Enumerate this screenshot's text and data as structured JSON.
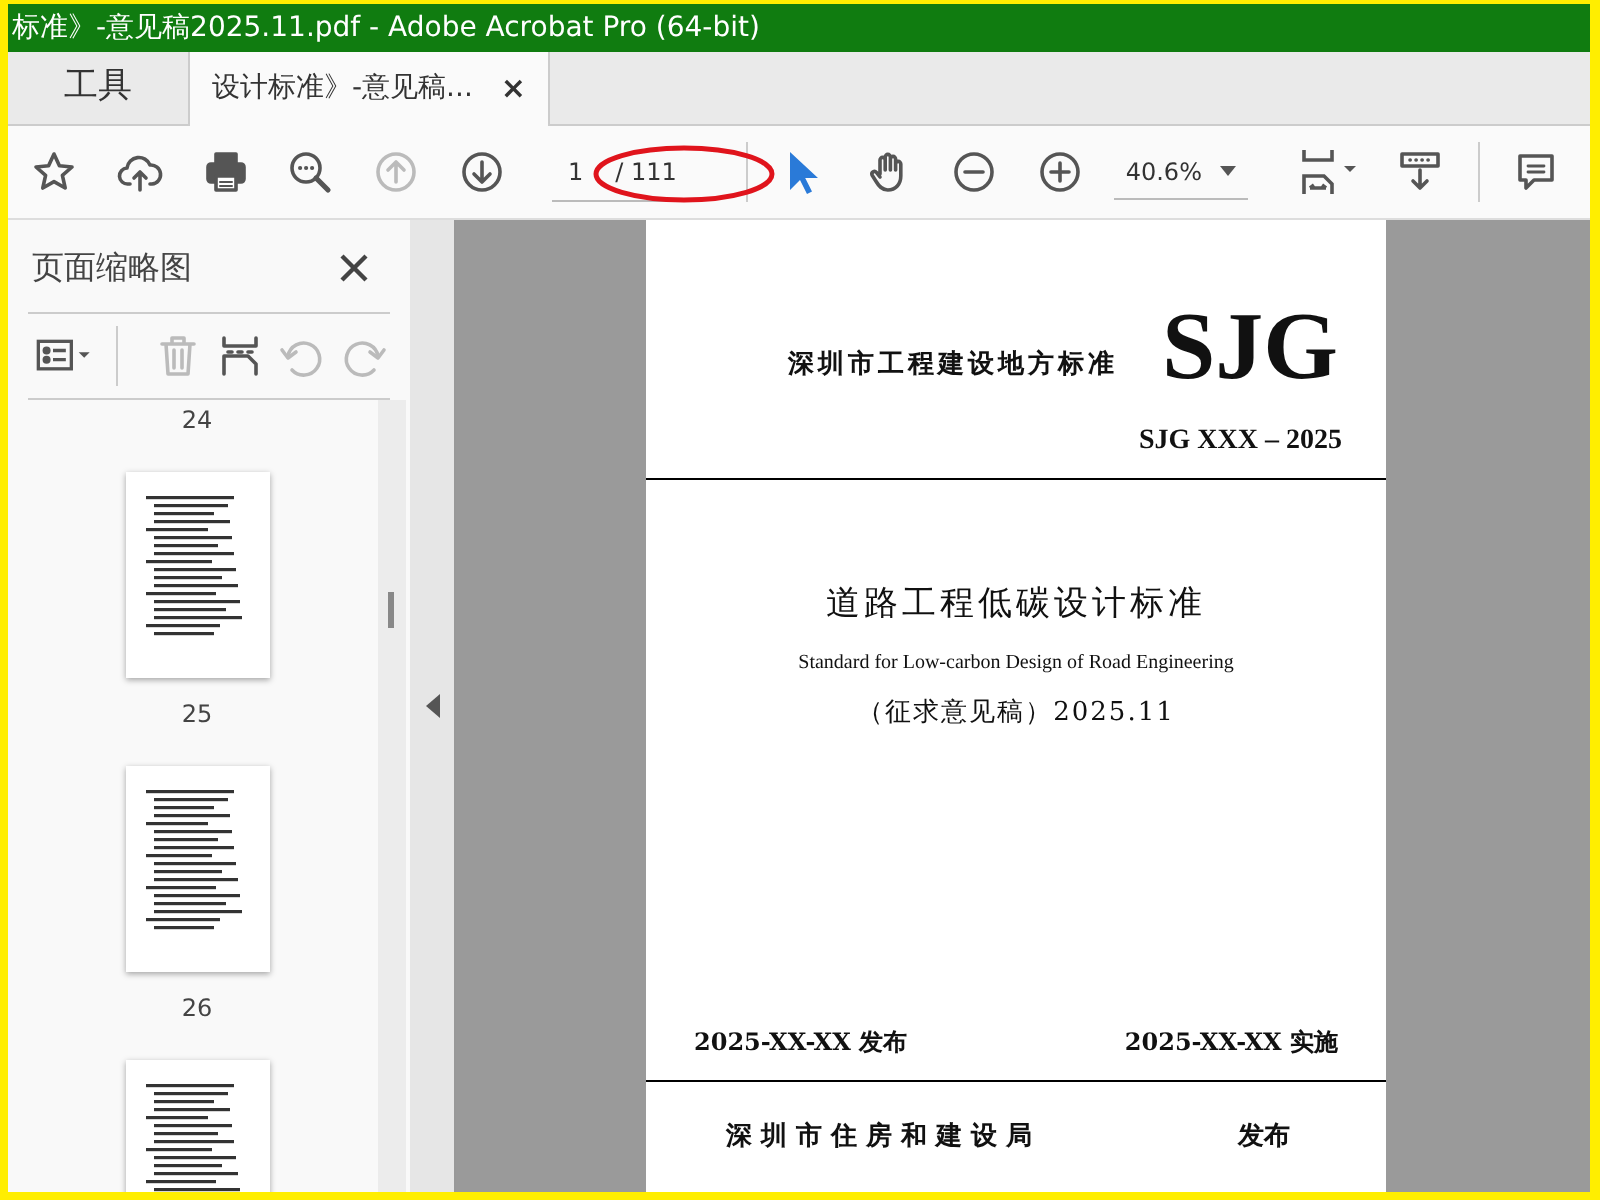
{
  "window": {
    "title": "标准》-意见稿2025.11.pdf - Adobe Acrobat Pro (64-bit)"
  },
  "tabs": [
    {
      "label": "工具",
      "selected": false
    },
    {
      "label": "设计标准》-意见稿...",
      "selected": true,
      "close": "×"
    }
  ],
  "toolbar": {
    "nav_buttons": [
      {
        "kind": "prev",
        "disabled": true
      },
      {
        "kind": "next",
        "disabled": false
      }
    ],
    "page_number": "1",
    "page_total": "/ 111",
    "zoom": "40.6%"
  },
  "sidebar": {
    "title": "页面缩略图",
    "tools": [
      {
        "kind": "delete",
        "disabled": true
      },
      {
        "kind": "insert",
        "disabled": false
      },
      {
        "kind": "rotate-left",
        "disabled": true
      },
      {
        "kind": "rotate-right",
        "disabled": true
      }
    ],
    "thumbnails": [
      {
        "kind": "label",
        "text": "24"
      },
      {
        "kind": "page"
      },
      {
        "kind": "label",
        "text": "25"
      },
      {
        "kind": "page"
      },
      {
        "kind": "label",
        "text": "26"
      },
      {
        "kind": "page"
      }
    ]
  },
  "document": {
    "org": "深圳市工程建设地方标准",
    "logo": "SJG",
    "number": "SJG XXX – 2025",
    "title": "道路工程低碳设计标准",
    "title_en": "Standard for Low-carbon Design of Road Engineering",
    "draft": "（征求意见稿）2025.11",
    "issue_date": "2025-XX-XX 发布",
    "effective_date": "2025-XX-XX 实施",
    "issuer": "深 圳 市 住 房 和 建 设 局",
    "issuer_action": "发布"
  }
}
